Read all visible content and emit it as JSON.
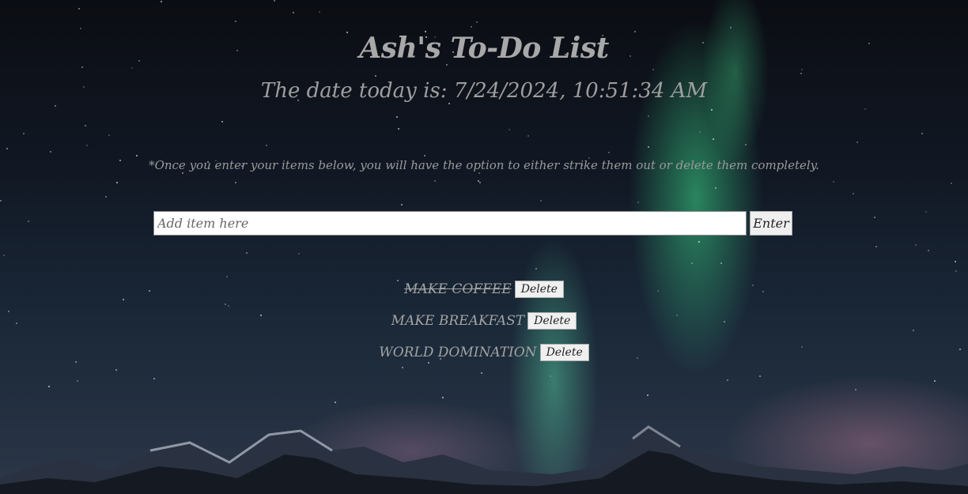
{
  "header": {
    "title": "Ash's To-Do List",
    "date_line": "The date today is: 7/24/2024, 10:51:34 AM"
  },
  "note": "*Once you enter your items below, you will have the option to either strike them out or delete them completely.",
  "form": {
    "placeholder": "Add item here",
    "value": "",
    "enter_label": "Enter"
  },
  "todos": [
    {
      "text": "MAKE COFFEE",
      "struck": true,
      "delete_label": "Delete"
    },
    {
      "text": "MAKE BREAKFAST",
      "struck": false,
      "delete_label": "Delete"
    },
    {
      "text": "WORLD DOMINATION",
      "struck": false,
      "delete_label": "Delete"
    }
  ],
  "colors": {
    "text": "#a9a9a9",
    "sky": "#0b0d13",
    "aurora": "#3cdc8c"
  }
}
